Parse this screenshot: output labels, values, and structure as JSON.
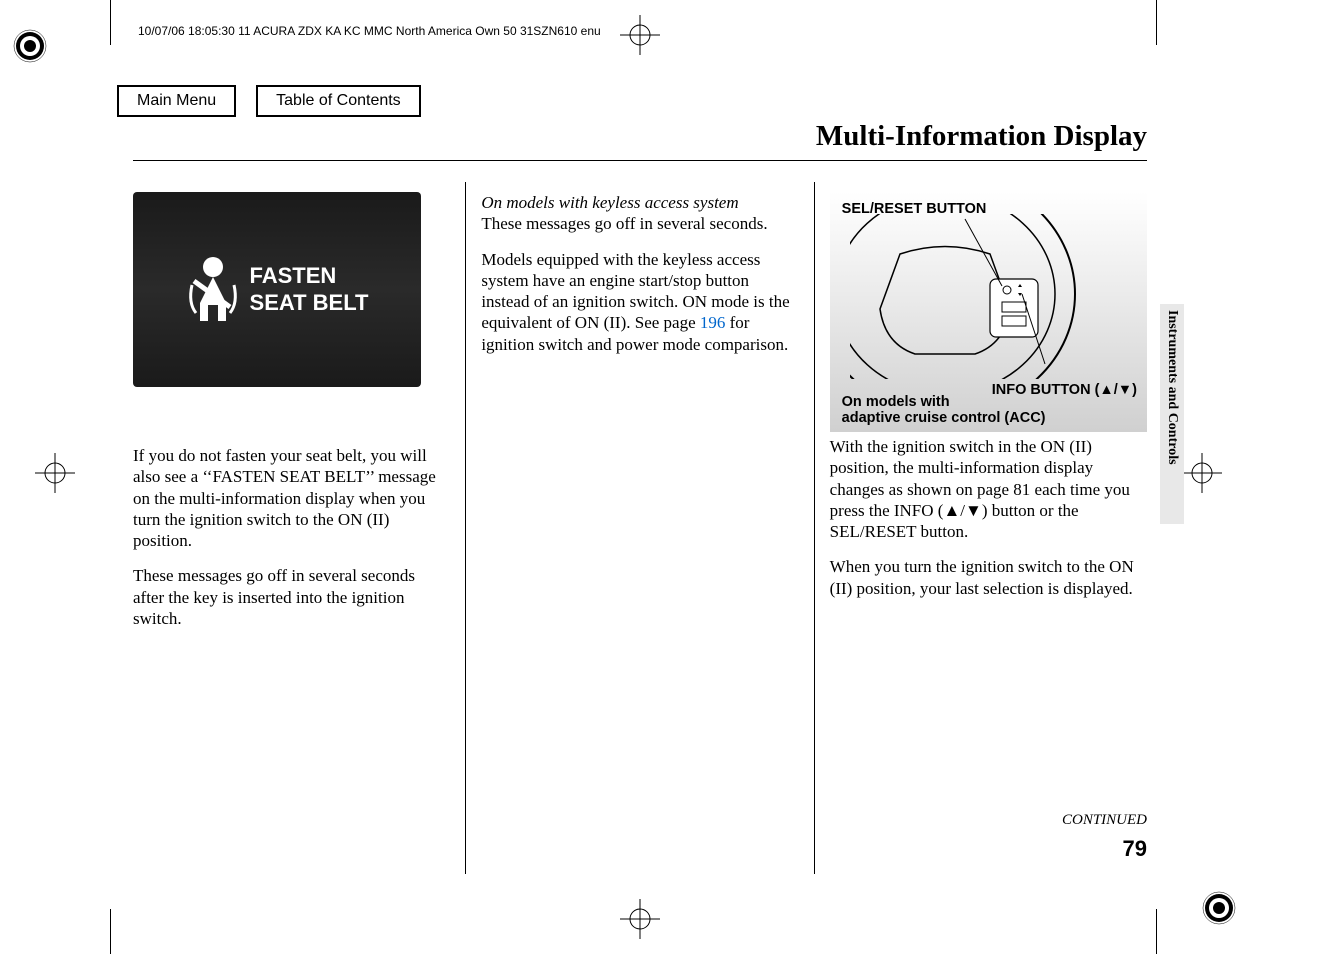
{
  "meta": {
    "header": "10/07/06 18:05:30   11 ACURA ZDX KA KC MMC North America Own 50 31SZN610 enu"
  },
  "nav": {
    "main_menu": "Main Menu",
    "toc": "Table of Contents"
  },
  "page": {
    "title": "Multi-Information Display",
    "continued": "CONTINUED",
    "number": "79",
    "side_tab": "Instruments and Controls"
  },
  "col1": {
    "display_line1": "FASTEN",
    "display_line2": "SEAT BELT",
    "p1": "If you do not fasten your seat belt, you will also see a ‘‘FASTEN SEAT BELT’’ message on the multi-information display when you turn the ignition switch to the ON (II) position.",
    "p2": "These messages go off in several seconds after the key is inserted into the ignition switch."
  },
  "col2": {
    "heading": "On models with keyless access system",
    "p1": "These messages go off in several seconds.",
    "p2a": "Models equipped with the keyless access system have an engine start/stop button instead of an ignition switch. ON mode is the equivalent of ON (II). See page ",
    "page_ref": "196",
    "p2b": " for ignition switch and power mode comparison."
  },
  "col3": {
    "label_sel": "SEL/RESET BUTTON",
    "label_info": "INFO BUTTON (▲/▼)",
    "acc_note": "On models with\nadaptive cruise control (ACC)",
    "p1": "With the ignition switch in the ON (II) position, the multi-information display changes as shown on page 81 each time you press the INFO (▲/▼) button or the SEL/RESET button.",
    "p2": "When you turn the ignition switch to the ON (II) position, your last selection is displayed."
  }
}
